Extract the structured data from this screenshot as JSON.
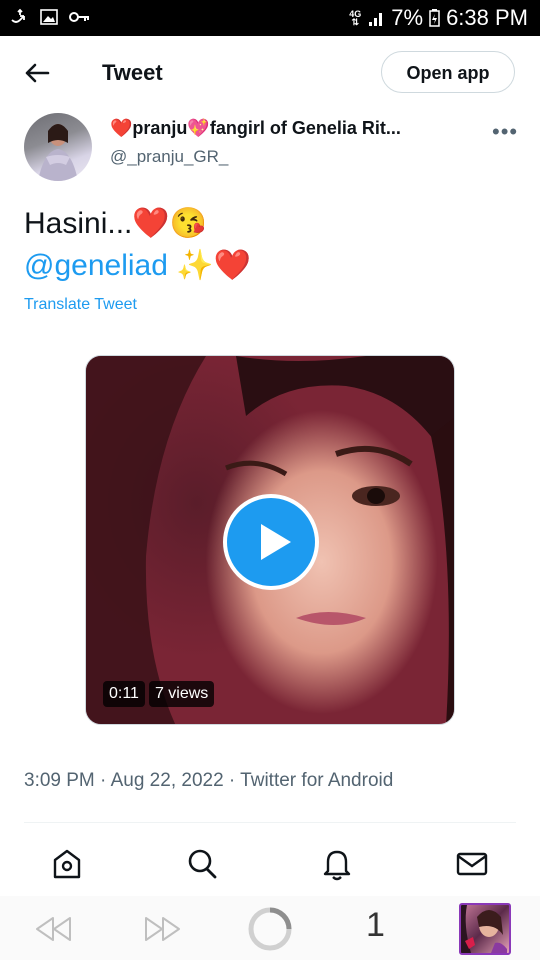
{
  "status_bar": {
    "network": "4G",
    "battery": "7%",
    "time": "6:38 PM"
  },
  "header": {
    "title": "Tweet",
    "open_app_label": "Open app"
  },
  "tweet": {
    "display_name": "❤️pranju💖fangirl of Genelia Rit...",
    "handle": "@_pranju_GR_",
    "text_line1": "Hasini...❤️😘",
    "mention": "@geneliad",
    "mention_suffix": " ✨❤️",
    "translate_label": "Translate Tweet",
    "video": {
      "duration": "0:11",
      "views": "7 views"
    },
    "meta": "3:09 PM · Aug 22, 2022 · Twitter for Android"
  },
  "browser_bar": {
    "tab_count": "1"
  },
  "colors": {
    "accent": "#1d9bf0",
    "secondary_text": "#536471",
    "profile_border": "#8a38b8"
  }
}
